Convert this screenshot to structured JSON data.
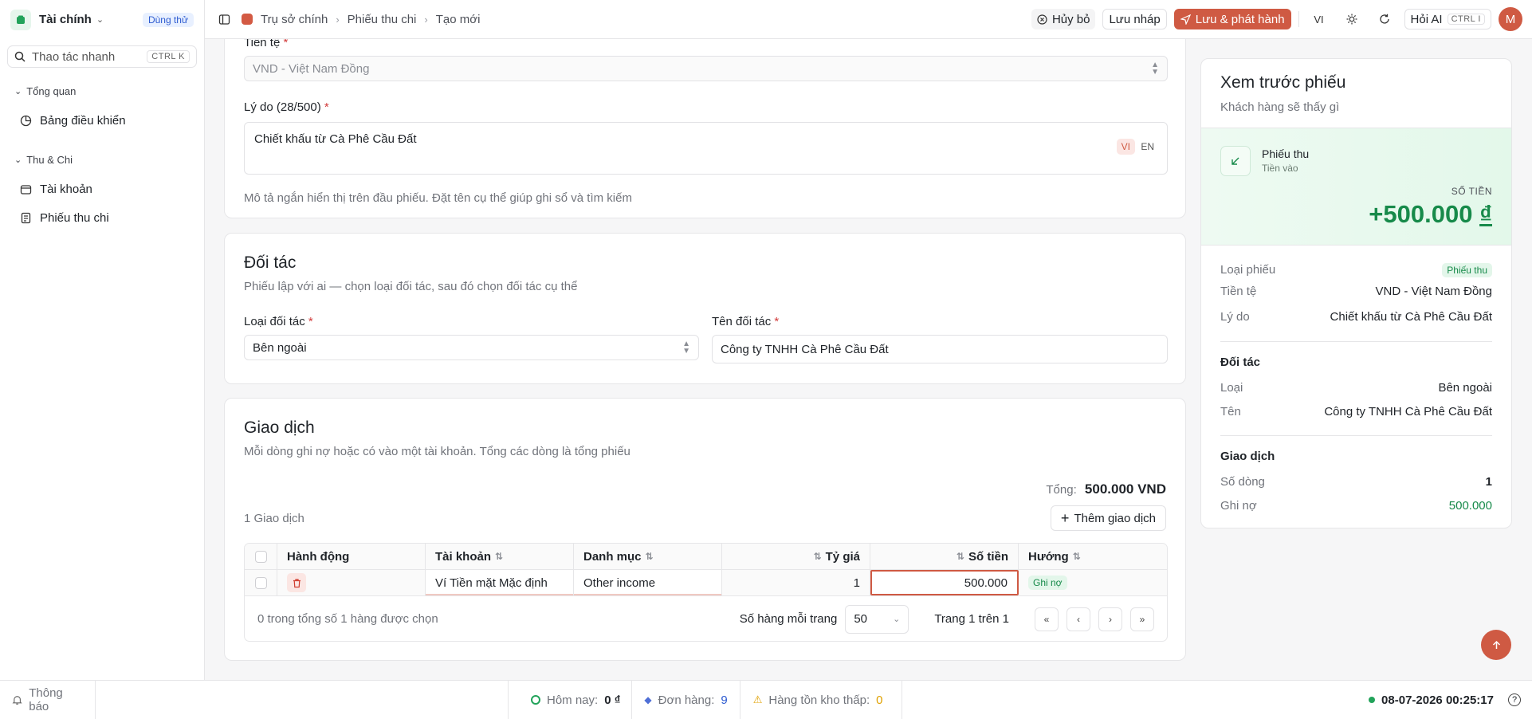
{
  "sidebar": {
    "app_name": "Tài chính",
    "trial_badge": "Dùng thử",
    "quick_action": {
      "label": "Thao tác nhanh",
      "shortcut": "CTRL K"
    },
    "groups": [
      {
        "title": "Tổng quan",
        "items": [
          {
            "label": "Bảng điều khiển"
          }
        ]
      },
      {
        "title": "Thu & Chi",
        "items": [
          {
            "label": "Tài khoản"
          },
          {
            "label": "Phiếu thu chi"
          }
        ]
      }
    ]
  },
  "topbar": {
    "breadcrumb": [
      "Trụ sở chính",
      "Phiếu thu chi",
      "Tạo mới"
    ],
    "cancel_label": "Hủy bỏ",
    "draft_label": "Lưu nháp",
    "publish_label": "Lưu & phát hành",
    "language": "VI",
    "ai_label": "Hỏi AI",
    "ai_shortcut": "CTRL I",
    "avatar_initial": "M"
  },
  "form": {
    "currency": {
      "label": "Tiền tệ",
      "value": "VND - Việt Nam Đồng"
    },
    "reason": {
      "label": "Lý do (28/500)",
      "value": "Chiết khấu từ Cà Phê Cầu Đất",
      "lang_vi": "VI",
      "lang_en": "EN",
      "hint": "Mô tả ngắn hiển thị trên đầu phiếu. Đặt tên cụ thể giúp ghi sổ và tìm kiếm"
    },
    "partner": {
      "title": "Đối tác",
      "subtitle": "Phiếu lập với ai — chọn loại đối tác, sau đó chọn đối tác cụ thể",
      "type_label": "Loại đối tác",
      "type_value": "Bên ngoài",
      "name_label": "Tên đối tác",
      "name_value": "Công ty TNHH Cà Phê Cầu Đất"
    },
    "transactions": {
      "title": "Giao dịch",
      "subtitle": "Mỗi dòng ghi nợ hoặc có vào một tài khoản. Tổng các dòng là tổng phiếu",
      "total_label": "Tổng:",
      "total_value": "500.000 VND",
      "count_label": "1 Giao dịch",
      "add_label": "Thêm giao dịch",
      "columns": [
        "Hành động",
        "Tài khoản",
        "Danh mục",
        "Tỷ giá",
        "Số tiền",
        "Hướng"
      ],
      "rows": [
        {
          "account": "Ví Tiền mặt Mặc định",
          "category": "Other income",
          "rate": "1",
          "amount": "500.000",
          "direction": "Ghi nợ"
        }
      ],
      "selected_text": "0 trong tổng số 1 hàng được chọn",
      "rows_per_page_label": "Số hàng mỗi trang",
      "rows_per_page": "50",
      "page_text": "Trang 1 trên 1"
    }
  },
  "preview": {
    "title": "Xem trước phiếu",
    "subtitle": "Khách hàng sẽ thấy gì",
    "receipt_type": "Phiếu thu",
    "receipt_sub": "Tiền vào",
    "amount_label": "SỐ TIỀN",
    "amount": "+500.000",
    "currency_symbol": "₫",
    "rows": [
      {
        "k": "Loại phiếu",
        "v": "Phiếu thu"
      },
      {
        "k": "Tiền tệ",
        "v": "VND - Việt Nam Đồng"
      },
      {
        "k": "Lý do",
        "v": "Chiết khấu từ Cà Phê Cầu Đất"
      }
    ],
    "partner_section": "Đối tác",
    "partner_rows": [
      {
        "k": "Loại",
        "v": "Bên ngoài"
      },
      {
        "k": "Tên",
        "v": "Công ty TNHH Cà Phê Cầu Đất"
      }
    ],
    "tx_section": "Giao dịch",
    "tx_rows": [
      {
        "k": "Số dòng",
        "v": "1"
      },
      {
        "k": "Ghi nợ",
        "v": "500.000"
      }
    ]
  },
  "statusbar": {
    "notifications": "Thông báo",
    "today_label": "Hôm nay:",
    "today_value": "0 ₫",
    "orders_label": "Đơn hàng:",
    "orders_value": "9",
    "low_stock_label": "Hàng tồn kho thấp:",
    "low_stock_value": "0",
    "datetime": "08-07-2026 00:25:17"
  },
  "colors": {
    "accent": "#cf5a43",
    "success": "#178a4a",
    "warning": "#e0a100"
  }
}
